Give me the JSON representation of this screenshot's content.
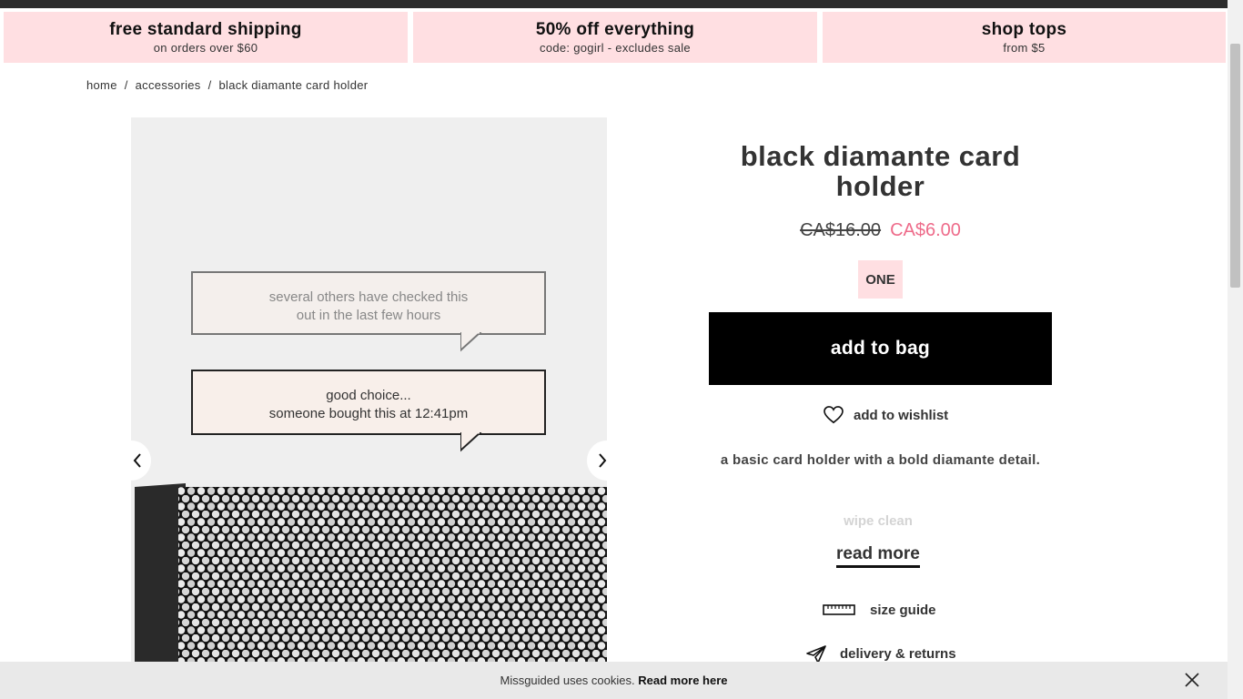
{
  "promos": [
    {
      "title": "free standard shipping",
      "subtitle": "on orders over $60"
    },
    {
      "title": "50% off everything",
      "subtitle": "code: gogirl - excludes sale"
    },
    {
      "title": "shop tops",
      "subtitle": "from $5"
    }
  ],
  "breadcrumb": {
    "home": "home",
    "category": "accessories",
    "current": "black diamante card holder",
    "separator": "/"
  },
  "gallery": {
    "bubble1": {
      "line1": "several others have checked this",
      "line2": "out in the last few hours"
    },
    "bubble2": {
      "line1": "good choice...",
      "line2": "someone bought this at 12:41pm"
    }
  },
  "product": {
    "title": "black diamante card holder",
    "old_price": "CA$16.00",
    "new_price": "CA$6.00",
    "size": "ONE",
    "add_to_bag": "add to bag",
    "wishlist": "add to wishlist",
    "description": "a basic card holder with a bold diamante detail.",
    "care": "wipe clean",
    "read_more": "read more",
    "size_guide": "size guide",
    "delivery": "delivery & returns"
  },
  "cookie": {
    "message": "Missguided uses cookies.",
    "link": "Read more here"
  },
  "colors": {
    "promo_bg": "#ffdfe2",
    "sale_price": "#ee6b8a",
    "button_bg": "#000000"
  }
}
